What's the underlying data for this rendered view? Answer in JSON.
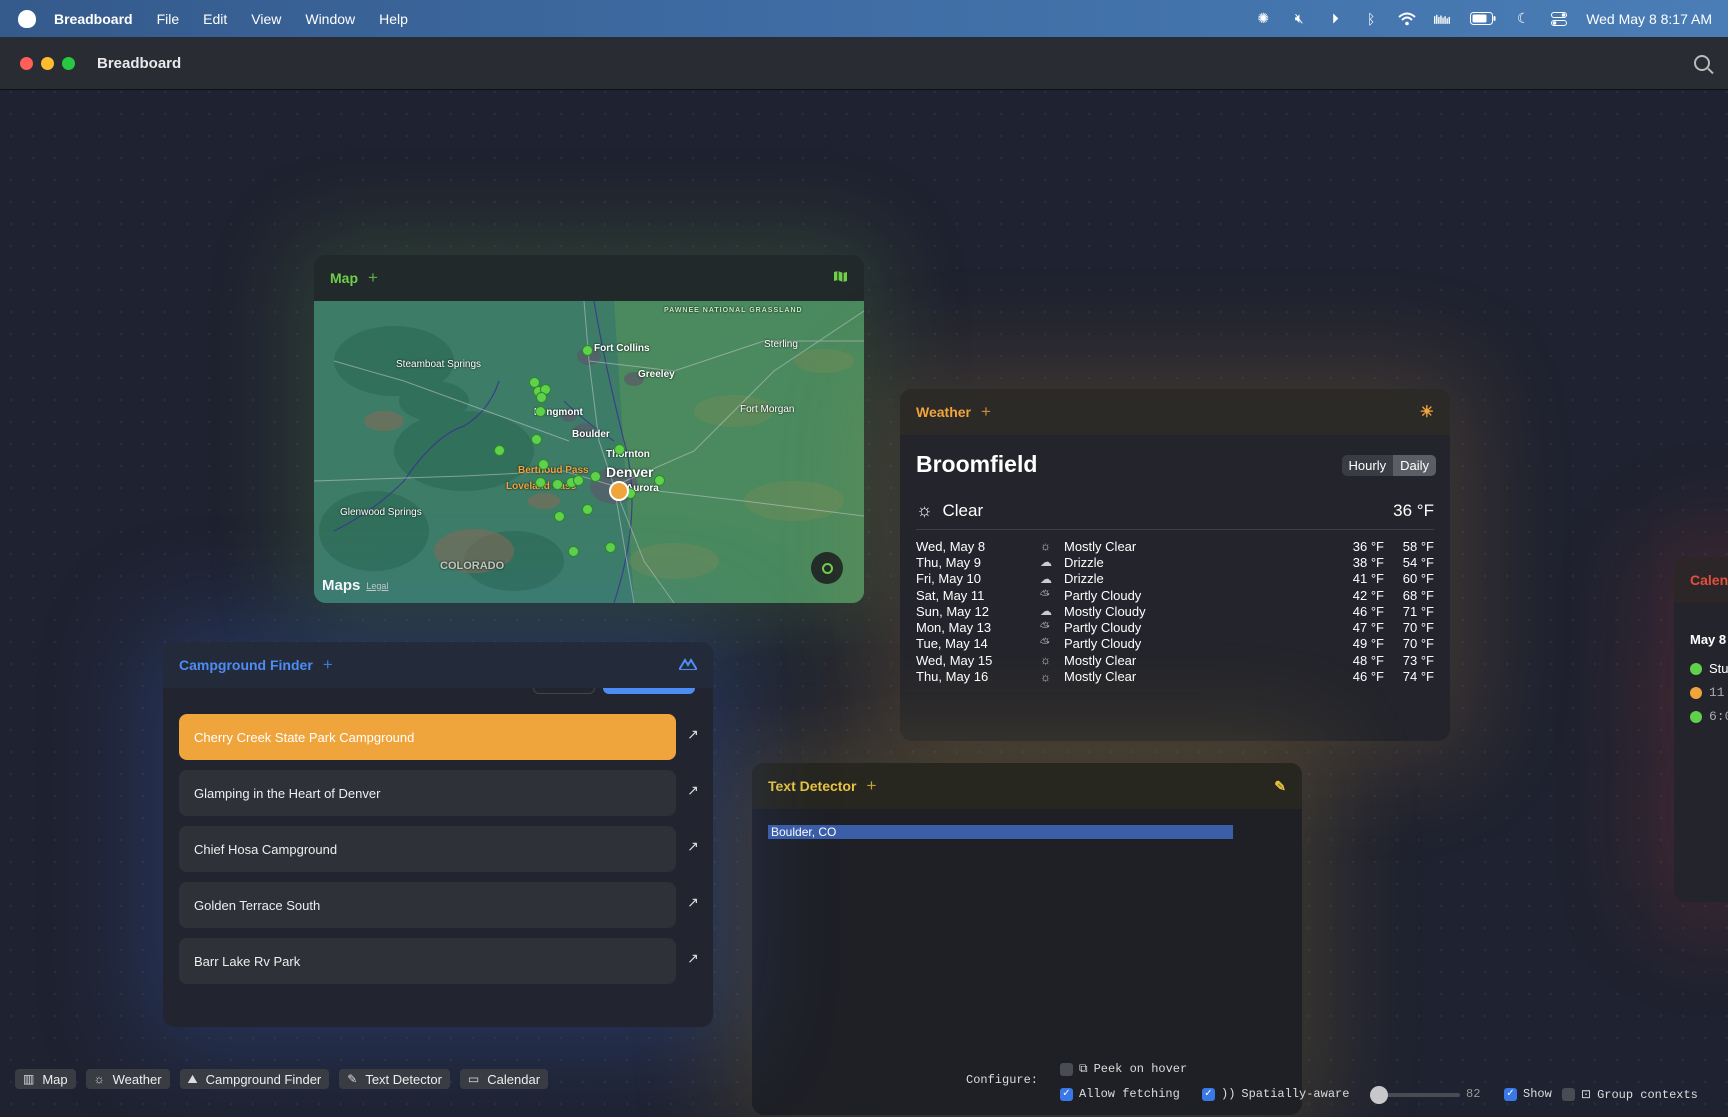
{
  "menubar": {
    "app": "Breadboard",
    "items": [
      "File",
      "Edit",
      "View",
      "Window",
      "Help"
    ],
    "datetime": "Wed May 8  8:17 AM",
    "status_icons": [
      "aperture-icon",
      "mute-icon",
      "play-circle-icon",
      "bluetooth-icon",
      "wifi-icon",
      "audio-meter-icon",
      "battery-icon",
      "moon-icon",
      "control-center-icon"
    ]
  },
  "window": {
    "title": "Breadboard"
  },
  "map_card": {
    "title": "Map",
    "accent": "#6fcf4a",
    "labels": {
      "fort_collins": "Fort Collins",
      "greeley": "Greeley",
      "sterling": "Sterling",
      "steamboat": "Steamboat Springs",
      "longmont": "Longmont",
      "fort_morgan": "Fort Morgan",
      "boulder": "Boulder",
      "thornton": "Thornton",
      "denver": "Denver",
      "aurora": "Aurora",
      "berthoud": "Berthoud Pass",
      "loveland": "Loveland Pass",
      "glenwood": "Glenwood Springs",
      "colorado": "COLORADO",
      "pawnee": "PAWNEE NATIONAL GRASSLAND",
      "maps_brand": "Maps",
      "legal": "Legal"
    }
  },
  "weather_card": {
    "title": "Weather",
    "accent": "#f0a43c",
    "city": "Broomfield",
    "modes": [
      "Hourly",
      "Daily"
    ],
    "active_mode": "Daily",
    "current": {
      "condition": "Clear",
      "temp": "36 °F"
    },
    "forecast": [
      {
        "day": "Wed, May 8",
        "icon": "sun-icon",
        "cond": "Mostly Clear",
        "lo": "36 °F",
        "hi": "58 °F"
      },
      {
        "day": "Thu, May 9",
        "icon": "drizzle-icon",
        "cond": "Drizzle",
        "lo": "38 °F",
        "hi": "54 °F"
      },
      {
        "day": "Fri, May 10",
        "icon": "drizzle-icon",
        "cond": "Drizzle",
        "lo": "41 °F",
        "hi": "60 °F"
      },
      {
        "day": "Sat, May 11",
        "icon": "partly-cloudy-icon",
        "cond": "Partly Cloudy",
        "lo": "42 °F",
        "hi": "68 °F"
      },
      {
        "day": "Sun, May 12",
        "icon": "cloud-icon",
        "cond": "Mostly Cloudy",
        "lo": "46 °F",
        "hi": "71 °F"
      },
      {
        "day": "Mon, May 13",
        "icon": "partly-cloudy-icon",
        "cond": "Partly Cloudy",
        "lo": "47 °F",
        "hi": "70 °F"
      },
      {
        "day": "Tue, May 14",
        "icon": "partly-cloudy-icon",
        "cond": "Partly Cloudy",
        "lo": "49 °F",
        "hi": "70 °F"
      },
      {
        "day": "Wed, May 15",
        "icon": "sun-icon",
        "cond": "Mostly Clear",
        "lo": "48 °F",
        "hi": "73 °F"
      },
      {
        "day": "Thu, May 16",
        "icon": "sun-icon",
        "cond": "Mostly Clear",
        "lo": "46 °F",
        "hi": "74 °F"
      }
    ]
  },
  "campground_card": {
    "title": "Campground Finder",
    "accent": "#4d8cf5",
    "items": [
      "Cherry Creek State Park Campground",
      "Glamping in the Heart of Denver",
      "Chief Hosa Campground",
      "Golden Terrace South",
      "Barr Lake Rv Park"
    ],
    "selected": 0
  },
  "text_detector_card": {
    "title": "Text Detector",
    "accent": "#e8c440",
    "detected_text": "Boulder, CO",
    "configure_label": "Configure:",
    "options": {
      "peek_on_hover": "Peek on hover",
      "allow_fetching": "Allow fetching",
      "spatially_aware": "Spatially-aware",
      "slider_value": "82",
      "show": "Show",
      "group_contexts": "Group contexts"
    },
    "checked": {
      "peek_on_hover": false,
      "allow_fetching": true,
      "spatially_aware": true,
      "show": true,
      "group_contexts": false
    }
  },
  "calendar_card": {
    "title": "Calen",
    "accent": "#e0503c",
    "date": "May 8",
    "entries": [
      "Stu",
      "11",
      "6:0"
    ]
  },
  "dock": [
    {
      "label": "Map",
      "icon": "map-icon"
    },
    {
      "label": "Weather",
      "icon": "sun-icon"
    },
    {
      "label": "Campground Finder",
      "icon": "mountains-icon"
    },
    {
      "label": "Text Detector",
      "icon": "pencil-icon"
    },
    {
      "label": "Calendar",
      "icon": "calendar-icon"
    }
  ]
}
